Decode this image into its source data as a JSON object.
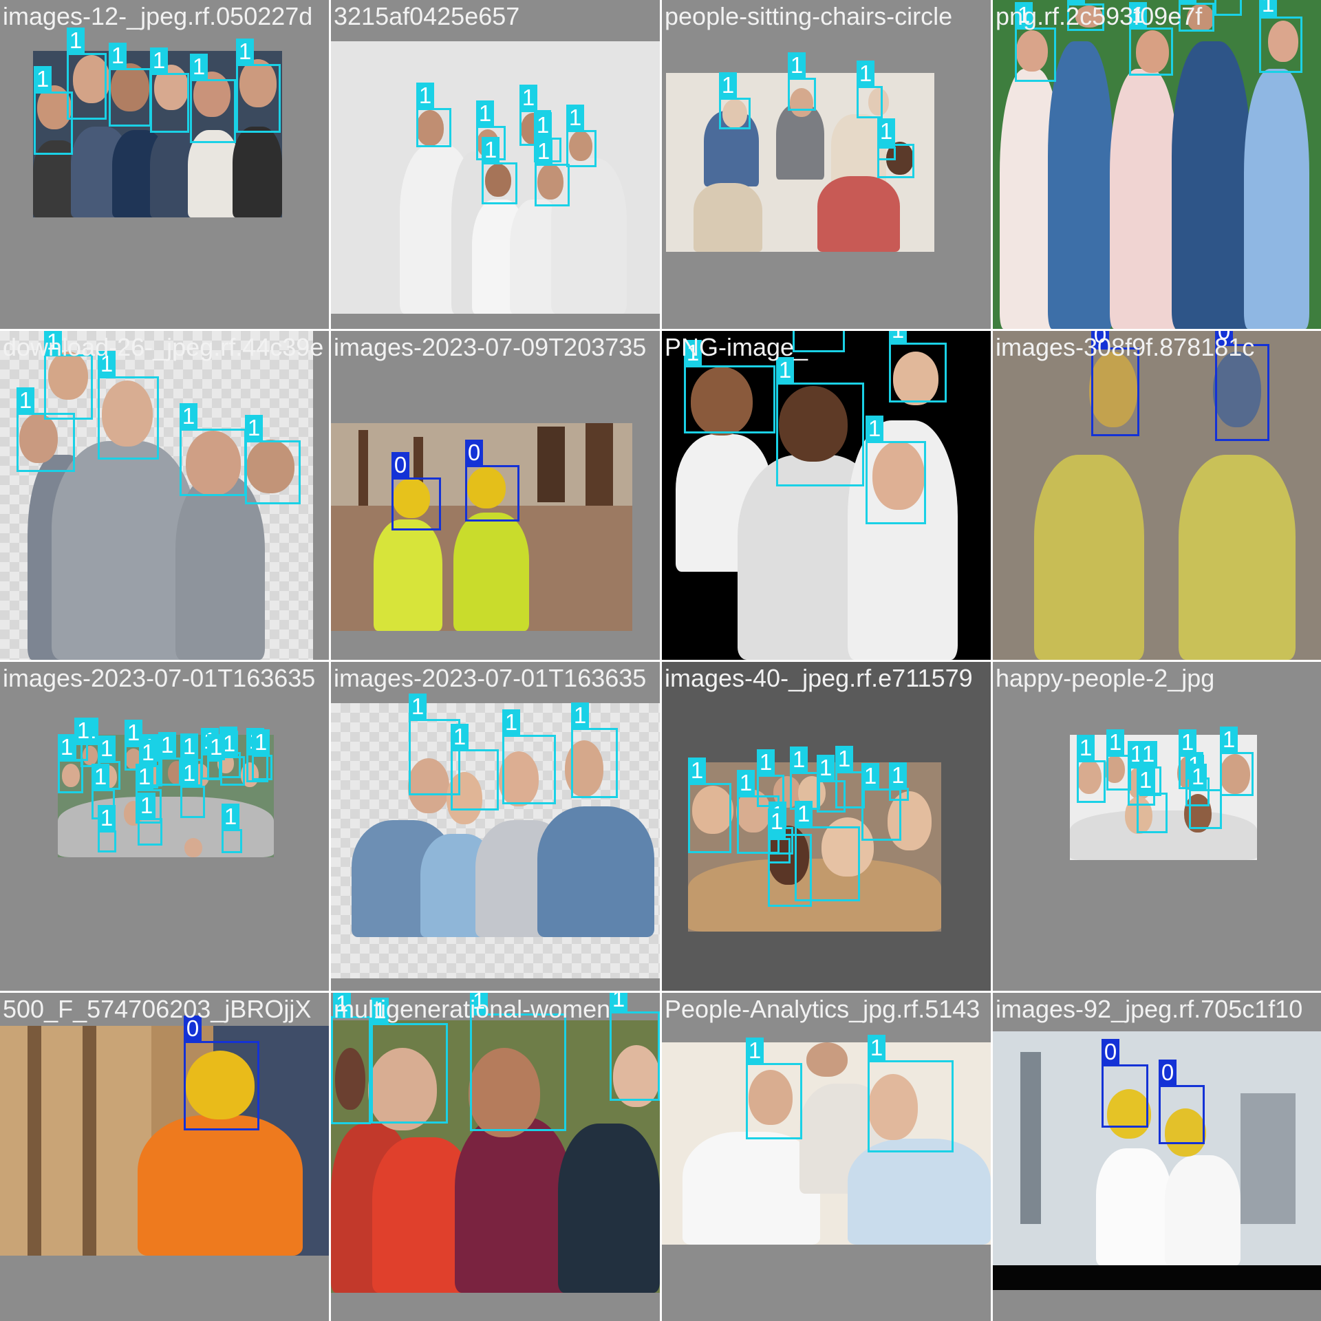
{
  "colors": {
    "class_1_box": "#1ad1e6",
    "class_0_box": "#1432d6",
    "tile_background": "#8c8c8c"
  },
  "tiles": [
    {
      "caption": "images-12-_jpeg.rf.050227d",
      "labels": [
        "1",
        "1",
        "1",
        "1",
        "1",
        "1"
      ]
    },
    {
      "caption": "3215af0425e657",
      "labels": [
        "1",
        "1",
        "1",
        "1",
        "1",
        "1",
        "1"
      ]
    },
    {
      "caption": "people-sitting-chairs-circle",
      "labels": [
        "1",
        "1",
        "1",
        "1",
        "1"
      ]
    },
    {
      "caption": "png.rf.2c593f09e7f",
      "labels": [
        "1",
        "1",
        "1",
        "1",
        "1",
        "1"
      ]
    },
    {
      "caption": "download-26-_jpeg.rf.44c39e",
      "labels": [
        "1",
        "1",
        "1",
        "1",
        "1"
      ]
    },
    {
      "caption": "images-2023-07-09T203735",
      "labels": [
        "0",
        "0"
      ]
    },
    {
      "caption": "PNG-image_",
      "labels": [
        "1",
        "1",
        "1",
        "1",
        "1"
      ]
    },
    {
      "caption": "images-308f9f.878181c",
      "labels": [
        "0",
        "0"
      ]
    },
    {
      "caption": "images-2023-07-01T163635",
      "labels": [
        "1",
        "1",
        "1",
        "1",
        "1",
        "1",
        "1",
        "1",
        "1",
        "1",
        "1",
        "1",
        "1",
        "1",
        "1",
        "1",
        "1",
        "1",
        "1",
        "1",
        "1"
      ]
    },
    {
      "caption": "images-2023-07-01T163635",
      "labels": [
        "1",
        "1",
        "1",
        "1",
        "1"
      ]
    },
    {
      "caption": "images-40-_jpeg.rf.e711579",
      "labels": [
        "1",
        "1",
        "1",
        "1",
        "1",
        "1",
        "1",
        "1",
        "1",
        "1",
        "1",
        "1"
      ]
    },
    {
      "caption": "happy-people-2_jpg",
      "labels": [
        "1",
        "1",
        "1",
        "1",
        "1",
        "1",
        "1",
        "1",
        "1"
      ]
    },
    {
      "caption": "500_F_574706203_jBROjjX",
      "labels": [
        "0"
      ]
    },
    {
      "caption": "multigenerational-women",
      "labels": [
        "1",
        "1",
        "1",
        "1"
      ]
    },
    {
      "caption": "People-Analytics_jpg.rf.5143",
      "labels": [
        "1",
        "1"
      ]
    },
    {
      "caption": "images-92_jpeg.rf.705c1f10",
      "labels": [
        "0",
        "0"
      ]
    }
  ]
}
